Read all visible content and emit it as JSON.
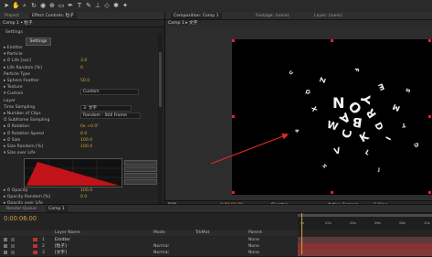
{
  "left_tabs": {
    "project": "Project",
    "effect_controls": "Effect Controls: 粒子"
  },
  "left_sub": "Comp 1 • 粒子",
  "settings": {
    "header": "Settings",
    "button": "Settings"
  },
  "rows": [
    {
      "label": "▸ Emitter",
      "value": ""
    },
    {
      "label": "▾ Particle",
      "value": ""
    },
    {
      "label": "▸ ⏱ Life [sec]",
      "value": "3.0"
    },
    {
      "label": "▸ Life Random [%]",
      "value": "0"
    },
    {
      "label": "  Particle Type",
      "value": ""
    },
    {
      "label": "▸ Sphere Feather",
      "value": "50.0"
    },
    {
      "label": "▸ Texture",
      "value": ""
    },
    {
      "label": "▾ Custom",
      "value": ""
    },
    {
      "label": "    Layer",
      "value": ""
    },
    {
      "label": "    Time Sampling",
      "value": ""
    },
    {
      "label": "  ▸ Number of Clips",
      "value": "2"
    },
    {
      "label": "      ⏱ Subframe Sampling",
      "value": ""
    },
    {
      "label": "▸ ⏱ Rotation",
      "value": "0x +0.0°"
    },
    {
      "label": "▸ ⏱ Rotation Speed",
      "value": "0.0"
    },
    {
      "label": "▸ ⏱ Size",
      "value": "100.0"
    },
    {
      "label": "▸ Size Random [%]",
      "value": "100.0"
    },
    {
      "label": "▾ Size over Life",
      "value": ""
    }
  ],
  "dropdowns": {
    "particle_type": "Custom",
    "layer": "3. 文字",
    "time_sampling": "Random - Still Frame"
  },
  "bottom_rows": [
    {
      "label": "▸ ⏱ Opacity",
      "value": "100.0"
    },
    {
      "label": "▸ Opacity Random [%]",
      "value": "0.0"
    },
    {
      "label": "▸ Opacity over Life",
      "value": ""
    }
  ],
  "right_tabs": {
    "comp": "Composition: Comp 1",
    "footage": "Footage: (none)",
    "layer": "Layer: (none)"
  },
  "comp_sub": "Comp 1 ▸ 文字",
  "viewer_toolbar": {
    "zoom": "50%",
    "timecode": "0:00:06:00",
    "res": "Quarter",
    "camera": "Active Camera",
    "views": "1 View"
  },
  "timeline": {
    "render_queue": "Render Queue",
    "comp_tab": "Comp 1",
    "time": "0:00:06:00",
    "layer_name_header": "Layer Name",
    "mode_header": "Mode",
    "parent_header": "Parent",
    "trkmat_header": "TrkMat"
  },
  "ruler_ticks": [
    "0s",
    "02s",
    "04s",
    "06s",
    "08s",
    "10s"
  ],
  "layers": [
    {
      "num": "1",
      "name": "Emitter",
      "mode": "",
      "parent": "None"
    },
    {
      "num": "2",
      "name": "[粒子]",
      "mode": "Normal",
      "parent": "None"
    },
    {
      "num": "3",
      "name": "[文字]",
      "mode": "Normal",
      "parent": "None"
    }
  ],
  "particles": [
    "N",
    "O",
    "Y",
    "A",
    "B",
    "R",
    "C",
    "K",
    "W",
    "D",
    "Z",
    "E",
    "M",
    "X",
    "I",
    "V",
    "L",
    "Q",
    "S",
    "T",
    "P",
    "G",
    "H",
    "J",
    "U",
    "F"
  ],
  "colors": {
    "accent": "#d2a23c",
    "arrow": "#e02828",
    "graph_fill": "#c0141a",
    "track_green": "#4b7d3c"
  }
}
